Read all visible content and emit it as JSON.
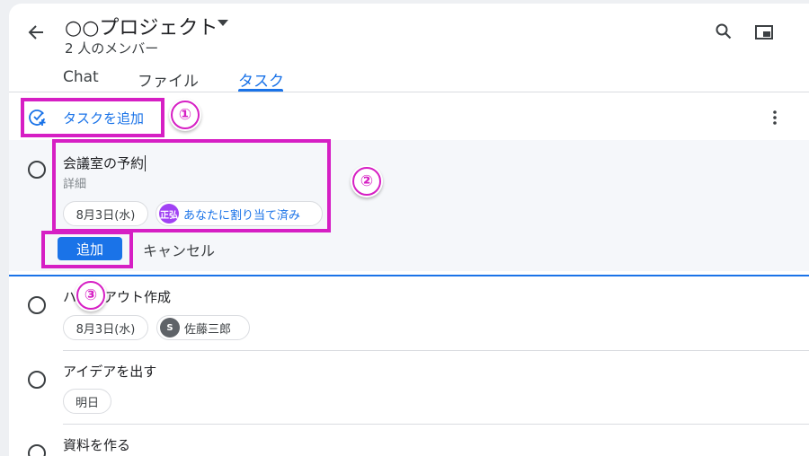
{
  "header": {
    "title": "○○プロジェクト",
    "members": "2 人のメンバー"
  },
  "tabs": [
    {
      "label": "Chat"
    },
    {
      "label": "ファイル"
    },
    {
      "label": "タスク"
    }
  ],
  "toolbar": {
    "add_task_label": "タスクを追加"
  },
  "new_task": {
    "title": "会議室の予約",
    "details_placeholder": "詳細",
    "date_chip": "8月3日(水)",
    "assignee_avatar": "正弘",
    "assignee_label": "あなたに割り当て済み",
    "add_button": "追加",
    "cancel_button": "キャンセル"
  },
  "tasks": [
    {
      "title": "ハンドアウト作成",
      "date_chip": "8月3日(水)",
      "assignee_initial": "S",
      "assignee_name": "佐藤三郎"
    },
    {
      "title": "アイデアを出す",
      "date_chip": "明日"
    },
    {
      "title": "資料を作る"
    }
  ],
  "annotations": [
    "①",
    "②",
    "③"
  ],
  "colors": {
    "accent": "#1a73e8",
    "highlight": "#d61fc4",
    "avatar_you": "#a142f4",
    "avatar_s": "#5f6368"
  },
  "icons": [
    "back-arrow-icon",
    "dropdown-caret-icon",
    "search-icon",
    "picture-in-picture-icon",
    "add-task-icon",
    "more-vert-icon",
    "checkbox-circle-icon"
  ]
}
